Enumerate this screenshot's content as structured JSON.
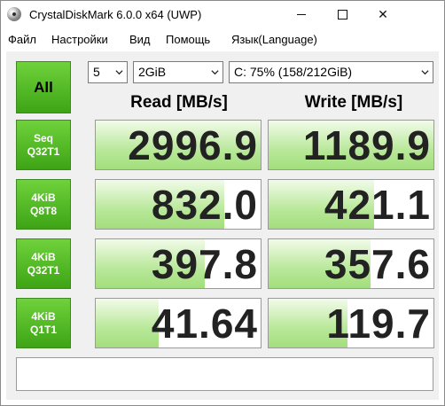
{
  "window": {
    "title": "CrystalDiskMark 6.0.0 x64 (UWP)",
    "close_glyph": "✕"
  },
  "menu": [
    "Файл",
    "Настройки",
    "Вид",
    "Помощь",
    "Язык(Language)"
  ],
  "controls": {
    "all_label": "All",
    "count": "5",
    "size": "2GiB",
    "drive": "C: 75% (158/212GiB)"
  },
  "headers": {
    "read": "Read [MB/s]",
    "write": "Write [MB/s]"
  },
  "rows": [
    {
      "line1": "Seq",
      "line2": "Q32T1",
      "read": "2996.9",
      "write": "1189.9",
      "read_fill_pct": 100,
      "write_fill_pct": 100
    },
    {
      "line1": "4KiB",
      "line2": "Q8T8",
      "read": "832.0",
      "write": "421.1",
      "read_fill_pct": 78,
      "write_fill_pct": 64
    },
    {
      "line1": "4KiB",
      "line2": "Q32T1",
      "read": "397.8",
      "write": "357.6",
      "read_fill_pct": 66,
      "write_fill_pct": 62
    },
    {
      "line1": "4KiB",
      "line2": "Q1T1",
      "read": "41.64",
      "write": "119.7",
      "read_fill_pct": 38,
      "write_fill_pct": 48
    }
  ],
  "comment": ""
}
